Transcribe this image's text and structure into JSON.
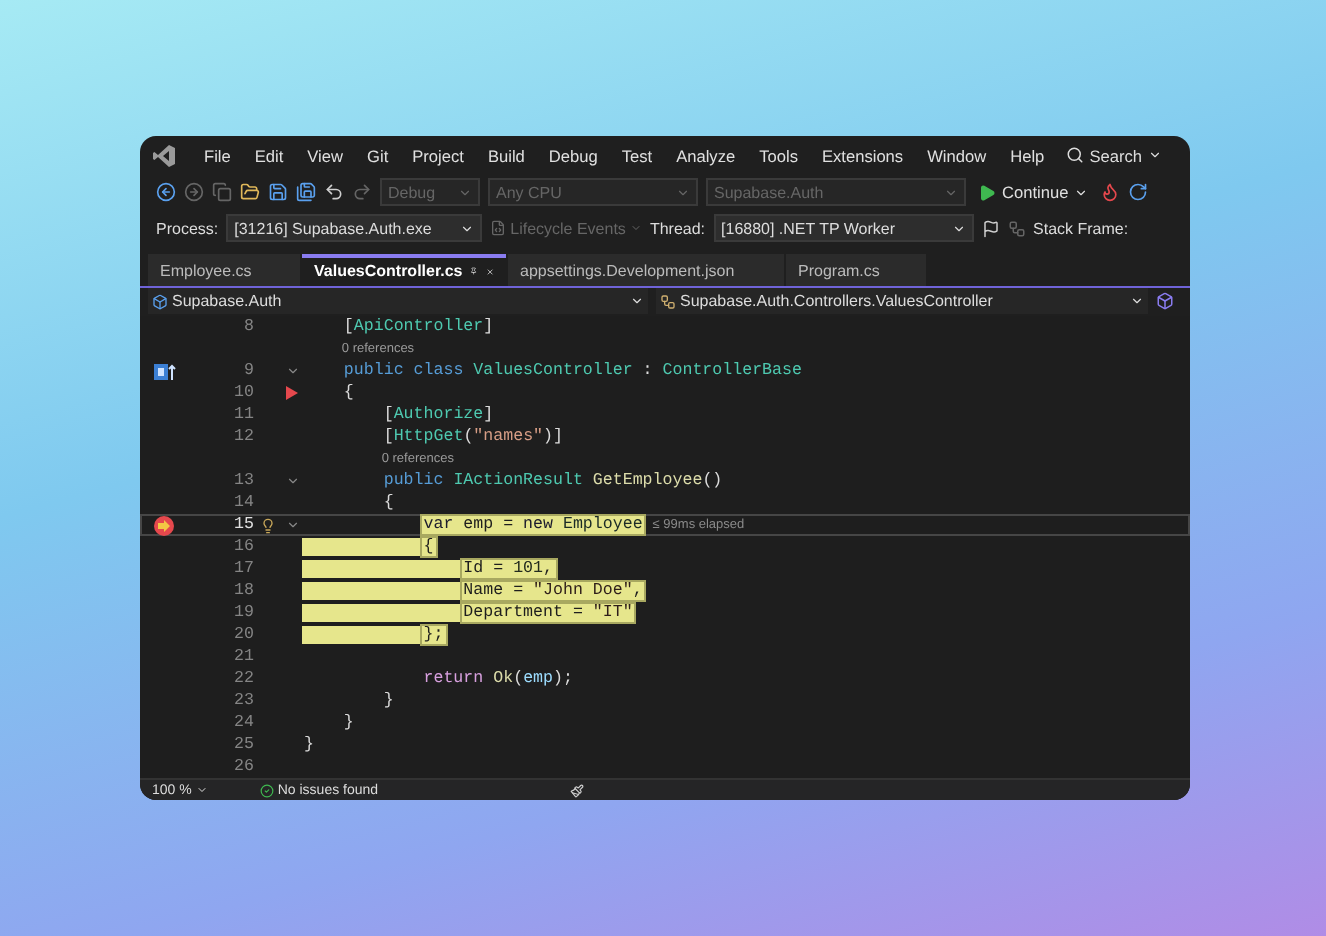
{
  "menu": {
    "items": [
      "File",
      "Edit",
      "View",
      "Git",
      "Project",
      "Build",
      "Debug",
      "Test",
      "Analyze",
      "Tools",
      "Extensions",
      "Window",
      "Help"
    ],
    "search": "Search"
  },
  "toolbar": {
    "dropdowns": [
      {
        "value": "Debug",
        "disabled": true
      },
      {
        "value": "Any CPU",
        "disabled": true
      },
      {
        "value": "Supabase.Auth",
        "disabled": true
      }
    ],
    "continue": "Continue"
  },
  "debug_bar": {
    "process_label": "Process:",
    "process": "[31216] Supabase.Auth.exe",
    "lifecycle": {
      "label": "Lifecycle Events",
      "disabled": true
    },
    "thread_label": "Thread:",
    "thread": "[16880] .NET TP Worker",
    "stack_frame_label": "Stack Frame:"
  },
  "tabs": [
    {
      "label": "Employee.cs",
      "selected": false
    },
    {
      "label": "ValuesController.cs",
      "selected": true
    },
    {
      "label": "appsettings.Development.json",
      "selected": false
    },
    {
      "label": "Program.cs",
      "selected": false
    }
  ],
  "nav_bar": {
    "project": "Supabase.Auth",
    "scope": "Supabase.Auth.Controllers.ValuesController"
  },
  "editor": {
    "lines": [
      {
        "kind": "code",
        "number": "8",
        "tokens": [
          {
            "text": "    [",
            "kind": "plain"
          },
          {
            "text": "ApiController",
            "kind": "type"
          },
          {
            "text": "]",
            "kind": "plain"
          }
        ]
      },
      {
        "kind": "codelens",
        "text": "    0 references"
      },
      {
        "kind": "code",
        "number": "9",
        "class_marker": true,
        "foldable": true,
        "tokens": [
          {
            "text": "    public class ",
            "kind": "kw"
          },
          {
            "text": "ValuesController",
            "kind": "type"
          },
          {
            "text": " : ",
            "kind": "plain"
          },
          {
            "text": "ControllerBase",
            "kind": "type"
          }
        ]
      },
      {
        "kind": "code",
        "number": "10",
        "marker": true,
        "tokens": [
          {
            "text": "    {",
            "kind": "plain"
          }
        ]
      },
      {
        "kind": "code",
        "number": "11",
        "tokens": [
          {
            "text": "        [",
            "kind": "plain"
          },
          {
            "text": "Authorize",
            "kind": "type"
          },
          {
            "text": "]",
            "kind": "plain"
          }
        ]
      },
      {
        "kind": "code",
        "number": "12",
        "tokens": [
          {
            "text": "        [",
            "kind": "plain"
          },
          {
            "text": "HttpGet",
            "kind": "type"
          },
          {
            "text": "(",
            "kind": "plain"
          },
          {
            "text": "\"names\"",
            "kind": "str"
          },
          {
            "text": ")]",
            "kind": "plain"
          }
        ]
      },
      {
        "kind": "codelens",
        "text": "        0 references"
      },
      {
        "kind": "code",
        "number": "13",
        "foldable": true,
        "tokens": [
          {
            "text": "        public ",
            "kind": "kw"
          },
          {
            "text": "IActionResult",
            "kind": "type"
          },
          {
            "text": " GetEmployee",
            "kind": "method"
          },
          {
            "text": "()",
            "kind": "plain"
          }
        ]
      },
      {
        "kind": "code",
        "number": "14",
        "tokens": [
          {
            "text": "        {",
            "kind": "plain"
          }
        ]
      },
      {
        "kind": "code",
        "number": "15",
        "breakpoint": true,
        "lightbulb": true,
        "foldable": true,
        "current": true,
        "highlighted": true,
        "tip": "≤ 99ms elapsed",
        "tokens": [
          {
            "text": "            var",
            "kind": "kw"
          },
          {
            "text": " emp = ",
            "kind": "plain"
          },
          {
            "text": "new",
            "kind": "kw"
          },
          {
            "text": " Employee",
            "kind": "type"
          }
        ]
      },
      {
        "kind": "code",
        "number": "16",
        "highlighted": true,
        "fill_margin": true,
        "tokens": [
          {
            "text": "            {",
            "kind": "plain"
          }
        ]
      },
      {
        "kind": "code",
        "number": "17",
        "highlighted": true,
        "fill_margin": true,
        "tokens": [
          {
            "text": "                Id = ",
            "kind": "plain"
          },
          {
            "text": "101",
            "kind": "num"
          },
          {
            "text": ",",
            "kind": "plain"
          }
        ]
      },
      {
        "kind": "code",
        "number": "18",
        "highlighted": true,
        "fill_margin": true,
        "tokens": [
          {
            "text": "                Name = ",
            "kind": "plain"
          },
          {
            "text": "\"John Doe\"",
            "kind": "str"
          },
          {
            "text": ",",
            "kind": "plain"
          }
        ]
      },
      {
        "kind": "code",
        "number": "19",
        "highlighted": true,
        "fill_margin": true,
        "tokens": [
          {
            "text": "                Department = ",
            "kind": "plain"
          },
          {
            "text": "\"IT\"",
            "kind": "str"
          }
        ]
      },
      {
        "kind": "code",
        "number": "20",
        "highlighted": true,
        "fill_margin": true,
        "tokens": [
          {
            "text": "            };",
            "kind": "plain"
          }
        ]
      },
      {
        "kind": "code",
        "number": "21"
      },
      {
        "kind": "code",
        "number": "22",
        "tokens": [
          {
            "text": "            return ",
            "kind": "ctrl"
          },
          {
            "text": "Ok",
            "kind": "method"
          },
          {
            "text": "(",
            "kind": "plain"
          },
          {
            "text": "emp",
            "kind": "var"
          },
          {
            "text": ");",
            "kind": "plain"
          }
        ]
      },
      {
        "kind": "code",
        "number": "23",
        "tokens": [
          {
            "text": "        }",
            "kind": "plain"
          }
        ]
      },
      {
        "kind": "code",
        "number": "24",
        "tokens": [
          {
            "text": "    }",
            "kind": "plain"
          }
        ]
      },
      {
        "kind": "code",
        "number": "25",
        "tokens": [
          {
            "text": "}",
            "kind": "plain"
          }
        ]
      },
      {
        "kind": "code",
        "number": "26"
      }
    ]
  },
  "status_bar": {
    "zoom": "100 %",
    "issues": "No issues found"
  }
}
